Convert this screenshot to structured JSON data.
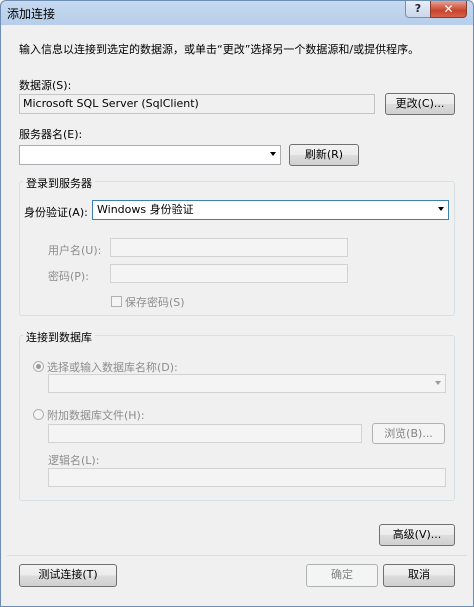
{
  "window": {
    "title": "添加连接",
    "help_glyph": "?",
    "close_glyph": "✕"
  },
  "intro": "输入信息以连接到选定的数据源，或单击“更改”选择另一个数据源和/或提供程序。",
  "data_source": {
    "label": "数据源(S):",
    "value": "Microsoft SQL Server (SqlClient)",
    "change_button": "更改(C)..."
  },
  "server": {
    "label": "服务器名(E):",
    "value": "",
    "refresh_button": "刷新(R)"
  },
  "login_group": {
    "title": "登录到服务器",
    "auth_label": "身份验证(A):",
    "auth_value": "Windows 身份验证",
    "username_label": "用户名(U):",
    "password_label": "密码(P):",
    "save_password_label": "保存密码(S)"
  },
  "db_group": {
    "title": "连接到数据库",
    "select_db_label": "选择或输入数据库名称(D):",
    "attach_file_label": "附加数据库文件(H):",
    "browse_button": "浏览(B)...",
    "logical_name_label": "逻辑名(L):"
  },
  "buttons": {
    "advanced": "高级(V)...",
    "test": "测试连接(T)",
    "ok": "确定",
    "cancel": "取消"
  }
}
